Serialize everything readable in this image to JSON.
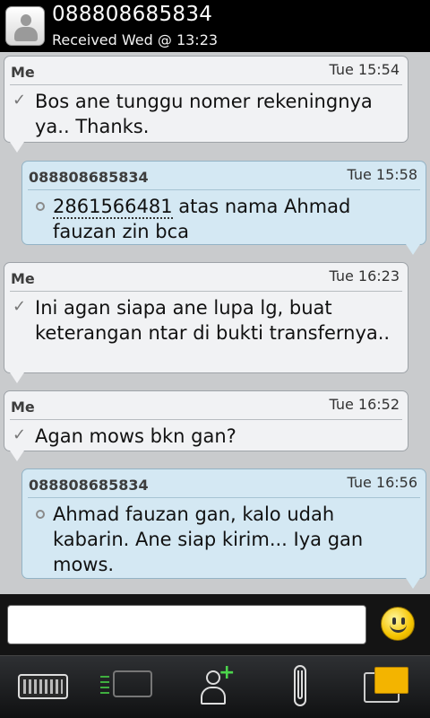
{
  "header": {
    "title": "088808685834",
    "subtitle": "Received Wed @ 13:23"
  },
  "messages": [
    {
      "sender": "Me",
      "time": "Tue 15:54",
      "text": "Bos ane tunggu nomer rekeningnya ya.. Thanks."
    },
    {
      "sender": "088808685834",
      "time": "Tue 15:58",
      "link": "2861566481",
      "text": " atas nama Ahmad fauzan zin bca"
    },
    {
      "sender": "Me",
      "time": "Tue 16:23",
      "text": "Ini agan siapa ane lupa lg, buat keterangan ntar di bukti transfernya.."
    },
    {
      "sender": "Me",
      "time": "Tue 16:52",
      "text": "Agan mows bkn gan?"
    },
    {
      "sender": "088808685834",
      "time": "Tue 16:56",
      "text": "Ahmad fauzan gan, kalo udah kabarin. Ane siap kirim... Iya gan mows."
    }
  ],
  "composer": {
    "value": "",
    "emoticon_icon": "smiley-icon"
  },
  "toolbar": {
    "items": [
      "keyboard-icon",
      "chat-icon",
      "add-contact-icon",
      "attachment-icon",
      "switch-chats-icon"
    ]
  }
}
